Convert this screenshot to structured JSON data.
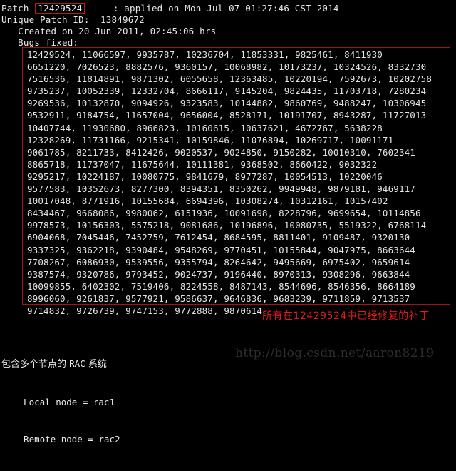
{
  "terminal": {
    "background_color": "#000000",
    "text_color": "#e8e8e8",
    "highlight_color": "#a01414",
    "annotation_color": "#e01b1b",
    "watermark_color": "#2e2e2e"
  },
  "header": {
    "patch_label": "Patch",
    "patch_id": "12429524",
    "applied_text": ": applied on Mon Jul 07 01:27:46 CST 2014",
    "unique_patch_id_line": "Unique Patch ID:  13849672",
    "created_line": "   Created on 20 Jun 2011, 02:45:06 hrs",
    "bugs_fixed_label": "   Bugs fixed:"
  },
  "bugs_fixed": {
    "lines": [
      "12429524, 11066597, 9935787, 10236704, 11853331, 9825461, 8411930",
      "6651220, 7026523, 8882576, 9360157, 10068982, 10173237, 10324526, 8332730",
      "7516536, 11814891, 9871302, 6055658, 12363485, 10220194, 7592673, 10202758",
      "9735237, 10052339, 12332704, 8666117, 9145204, 9824435, 11703718, 7280234",
      "9269536, 10132870, 9094926, 9323583, 10144882, 9860769, 9488247, 10306945",
      "9532911, 9184754, 11657004, 9656004, 8528171, 10191707, 8943287, 11727013",
      "10407744, 11930680, 8966823, 10160615, 10637621, 4672767, 5638228",
      "12328269, 11731166, 9215341, 10159846, 11076894, 10269717, 10091171",
      "9061785, 8211733, 8412426, 9020537, 9024850, 9150282, 10010310, 7602341",
      "8865718, 11737047, 11675644, 10111381, 9368502, 8660422, 9032322",
      "9295217, 10224187, 10080775, 9841679, 8977287, 10054513, 10220046",
      "9577583, 10352673, 8277300, 8394351, 8350262, 9949948, 9879181, 9469117",
      "10017048, 8771916, 10155684, 6694396, 10308274, 10312161, 10157402",
      "8434467, 9668086, 9980062, 6151936, 10091698, 8228796, 9699654, 10114856",
      "9978573, 10156303, 5575218, 9081686, 10196896, 10080735, 5519322, 6768114",
      "6904068, 7045446, 7452759, 7612454, 8684595, 8811401, 9109487, 9320130",
      "9337325, 9362218, 9390484, 9548269, 9770451, 10155844, 9047975, 8663644",
      "7708267, 6086930, 9539556, 9355794, 8264642, 9495669, 6975402, 9659614",
      "9387574, 9320786, 9793452, 9024737, 9196440, 8970313, 9308296, 9663844",
      "10099855, 6402302, 7519406, 8224558, 8487143, 8544696, 8546356, 8664189",
      "8996060, 9261837, 9577921, 9586637, 9646836, 9683239, 9711859, 9713537",
      "9714832, 9726739, 9747153, 9772888, 9870614"
    ]
  },
  "annotation": {
    "chinese_note": "所有在12429524中已经修复的补丁"
  },
  "footer": {
    "rac_prefix_cn": "包含多个节点的 ",
    "rac_mono": "RAC",
    "rac_suffix_cn": " 系统",
    "local_node": "  Local node = rac1",
    "remote_node": "  Remote node = rac2"
  },
  "watermark": {
    "url": "http://blog.csdn.net/aaron8219"
  }
}
